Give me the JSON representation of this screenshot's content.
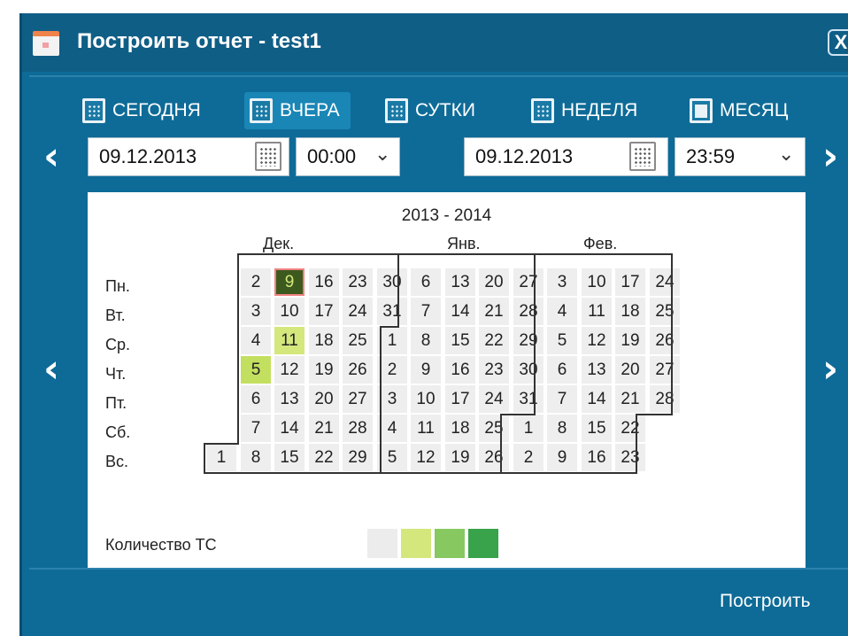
{
  "window": {
    "title": "Построить отчет - test1",
    "close_label": "X"
  },
  "presets": [
    {
      "label": "СЕГОДНЯ",
      "active": false
    },
    {
      "label": "ВЧЕРА",
      "active": true
    },
    {
      "label": "СУТКИ",
      "active": false
    },
    {
      "label": "НЕДЕЛЯ",
      "active": false
    },
    {
      "label": "МЕСЯЦ",
      "active": false
    }
  ],
  "range": {
    "start_date": "09.12.2013",
    "start_time": "00:00",
    "separator": "-",
    "end_date": "09.12.2013",
    "end_time": "23:59"
  },
  "calendar": {
    "year_range": "2013 - 2014",
    "months": [
      "Дек.",
      "Янв.",
      "Фев."
    ],
    "weekdays": [
      "Пн.",
      "Вт.",
      "Ср.",
      "Чт.",
      "Пт.",
      "Сб.",
      "Вс."
    ],
    "weeks": [
      [
        "",
        "",
        "",
        "",
        "",
        "",
        "1"
      ],
      [
        "2",
        "3",
        "4",
        "5",
        "6",
        "7",
        "8"
      ],
      [
        "9",
        "10",
        "11",
        "12",
        "13",
        "14",
        "15"
      ],
      [
        "16",
        "17",
        "18",
        "19",
        "20",
        "21",
        "22"
      ],
      [
        "23",
        "24",
        "25",
        "26",
        "27",
        "28",
        "29"
      ],
      [
        "30",
        "31",
        "1",
        "2",
        "3",
        "4",
        "5"
      ],
      [
        "6",
        "7",
        "8",
        "9",
        "10",
        "11",
        "12"
      ],
      [
        "13",
        "14",
        "15",
        "16",
        "17",
        "18",
        "19"
      ],
      [
        "20",
        "21",
        "22",
        "23",
        "24",
        "25",
        "26"
      ],
      [
        "27",
        "28",
        "29",
        "30",
        "31",
        "1",
        "2"
      ],
      [
        "3",
        "4",
        "5",
        "6",
        "7",
        "8",
        "9"
      ],
      [
        "10",
        "11",
        "12",
        "13",
        "14",
        "15",
        "16"
      ],
      [
        "17",
        "18",
        "19",
        "20",
        "21",
        "22",
        "23"
      ],
      [
        "24",
        "25",
        "26",
        "27",
        "28",
        "",
        ""
      ]
    ],
    "highlighted_days": [
      {
        "week": 2,
        "day": 0,
        "color": "#3d5a1e",
        "selected": true
      },
      {
        "week": 2,
        "day": 2,
        "color": "#d4e77c"
      },
      {
        "week": 1,
        "day": 3,
        "color": "#c3df5f"
      }
    ],
    "selected_border_color": "#f08080",
    "legend": {
      "label": "Количество ТС",
      "colors": [
        "#ececec",
        "#d4e77c",
        "#88c861",
        "#38a34a"
      ]
    }
  },
  "footer": {
    "build_label": "Построить"
  }
}
